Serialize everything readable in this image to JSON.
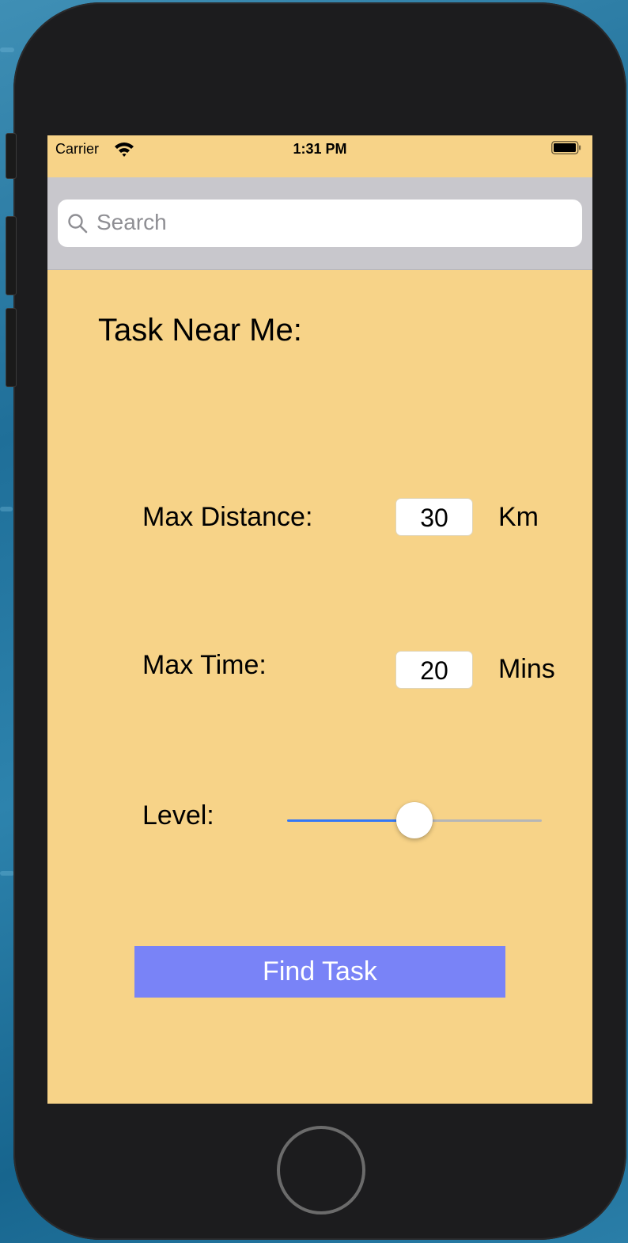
{
  "status_bar": {
    "carrier": "Carrier",
    "time": "1:31 PM"
  },
  "search": {
    "placeholder": "Search"
  },
  "page": {
    "title": "Task Near Me:"
  },
  "max_distance": {
    "label": "Max Distance:",
    "value": "30",
    "unit": "Km"
  },
  "max_time": {
    "label": "Max Time:",
    "value": "20",
    "unit": "Mins"
  },
  "level": {
    "label": "Level:",
    "value": 0.5
  },
  "find_button": {
    "label": "Find Task"
  },
  "colors": {
    "background": "#f7d388",
    "button": "#7983f7",
    "slider_min_track": "#3478f6"
  },
  "icons": {
    "wifi": "wifi-icon",
    "battery": "battery-icon",
    "search": "search-icon"
  }
}
